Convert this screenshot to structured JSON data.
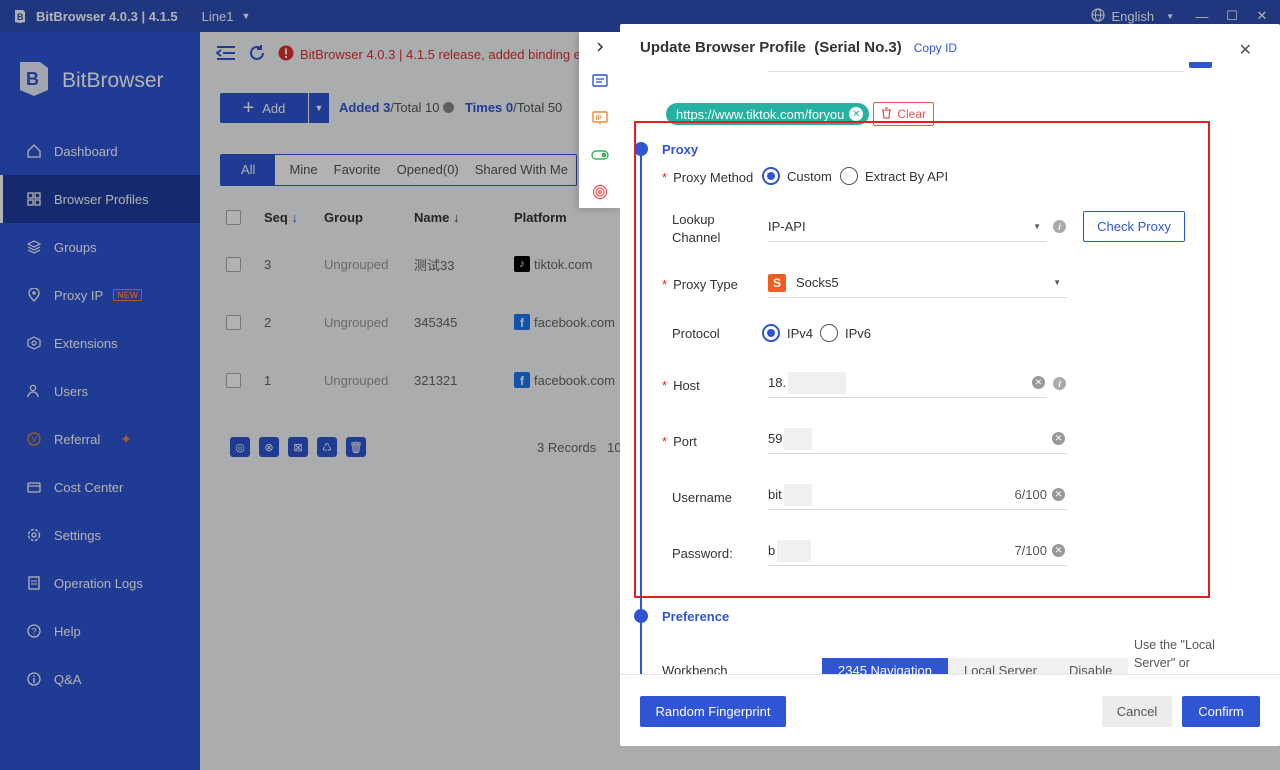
{
  "titlebar": {
    "title": "BitBrowser 4.0.3 | 4.1.5",
    "line": "Line1",
    "language": "English"
  },
  "sidebar": {
    "brand": "BitBrowser",
    "items": [
      {
        "label": "Dashboard",
        "icon": "home-icon"
      },
      {
        "label": "Browser Profiles",
        "icon": "grid-icon",
        "active": true
      },
      {
        "label": "Groups",
        "icon": "layers-icon"
      },
      {
        "label": "Proxy IP",
        "icon": "location-pin-icon",
        "badge": "NEW"
      },
      {
        "label": "Extensions",
        "icon": "puzzle-icon"
      },
      {
        "label": "Users",
        "icon": "users-icon"
      },
      {
        "label": "Referral",
        "icon": "referral-icon"
      },
      {
        "label": "Cost Center",
        "icon": "wallet-icon"
      },
      {
        "label": "Settings",
        "icon": "gear-icon"
      },
      {
        "label": "Operation Logs",
        "icon": "log-icon"
      },
      {
        "label": "Help",
        "icon": "help-icon"
      },
      {
        "label": "Q&A",
        "icon": "info-icon"
      }
    ]
  },
  "main": {
    "notice": "BitBrowser 4.0.3 | 4.1.5 release, added binding em",
    "add_label": "Add",
    "stats": {
      "added_label": "Added",
      "added": "3",
      "total_label": "/Total 10",
      "times_label": "Times",
      "times": "0",
      "times_total": "/Total 50"
    },
    "tabs": [
      "All",
      "Mine",
      "Favorite",
      "Opened(0)",
      "Shared With Me"
    ],
    "columns": {
      "seq": "Seq",
      "group": "Group",
      "name": "Name",
      "platform": "Platform"
    },
    "rows": [
      {
        "seq": "3",
        "group": "Ungrouped",
        "name": "测试33",
        "platform": "tiktok.com",
        "icon": "tiktok"
      },
      {
        "seq": "2",
        "group": "Ungrouped",
        "name": "345345",
        "platform": "facebook.com",
        "icon": "facebook"
      },
      {
        "seq": "1",
        "group": "Ungrouped",
        "name": "321321",
        "platform": "facebook.com",
        "icon": "facebook"
      }
    ],
    "records": "3 Records",
    "records_more": "10"
  },
  "modal": {
    "title": "Update Browser Profile",
    "serial": "(Serial No.3)",
    "copy_id": "Copy ID",
    "url_tag": "https://www.tiktok.com/foryou",
    "clear_label": "Clear",
    "proxy_section": "Proxy",
    "proxy_method_label": "Proxy Method",
    "method_custom": "Custom",
    "method_api": "Extract By API",
    "lookup_label_1": "Lookup",
    "lookup_label_2": "Channel",
    "lookup_value": "IP-API",
    "check_proxy": "Check Proxy",
    "proxy_type_label": "Proxy Type",
    "proxy_type_value": "Socks5",
    "protocol_label": "Protocol",
    "ipv4": "IPv4",
    "ipv6": "IPv6",
    "host_label": "Host",
    "host_value": "18.",
    "port_label": "Port",
    "port_value": "59",
    "username_label": "Username",
    "username_value": "bit",
    "username_count": "6/100",
    "password_label": "Password:",
    "password_value": "b",
    "password_count": "7/100",
    "preference_section": "Preference",
    "workbench_label": "Workbench",
    "workbench_options": [
      "2345 Navigation",
      "Local Server",
      "Disable"
    ],
    "workbench_hint": "Use the \"Local Server\" or",
    "random_fp": "Random Fingerprint",
    "cancel": "Cancel",
    "confirm": "Confirm"
  },
  "colors": {
    "primary": "#2f55d4",
    "danger": "#e32020",
    "tag": "#25b2a0",
    "socks": "#f25d22"
  }
}
